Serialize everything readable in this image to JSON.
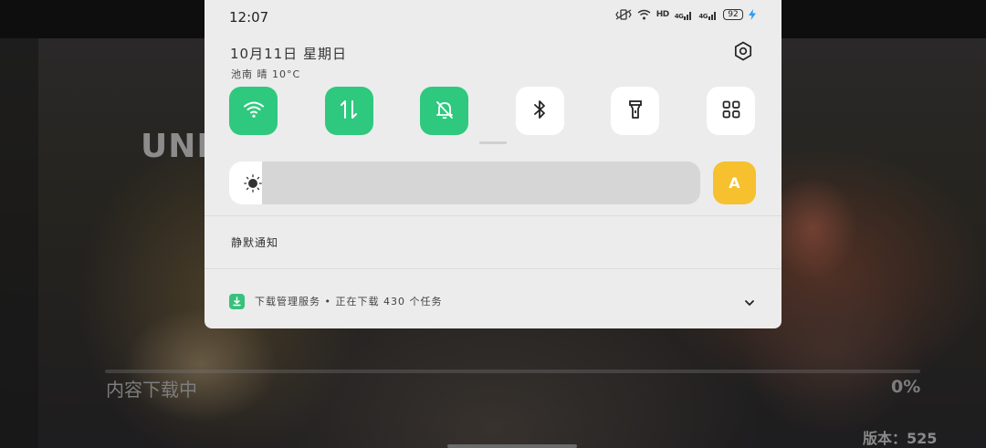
{
  "status_bar": {
    "time": "12:07",
    "hd_label": "HD",
    "network_1": "4G",
    "network_2": "4G",
    "battery_level": "92",
    "charging_icon": "bolt-icon"
  },
  "header": {
    "date": "10月11日  星期日",
    "weather": "池南 晴 10°C",
    "settings_icon": "gear-icon"
  },
  "quick_tiles": [
    {
      "name": "wifi",
      "icon": "wifi-icon",
      "on": true
    },
    {
      "name": "mobile-data",
      "icon": "data-arrows-icon",
      "on": true
    },
    {
      "name": "silent",
      "icon": "bell-off-icon",
      "on": true
    },
    {
      "name": "bluetooth",
      "icon": "bluetooth-icon",
      "on": false
    },
    {
      "name": "flashlight",
      "icon": "flashlight-icon",
      "on": false
    },
    {
      "name": "more",
      "icon": "grid-icon",
      "on": false
    }
  ],
  "brightness": {
    "level": 0.07,
    "icon": "sun-icon",
    "auto_label": "A"
  },
  "notifications": {
    "section_label": "静默通知",
    "item": {
      "app_icon": "download-icon",
      "text": "下载管理服务 • 正在下载 430 个任务",
      "expand_icon": "chevron-down-icon"
    }
  },
  "game": {
    "logo_text": "UND",
    "loading_label": "内容下载中",
    "loading_percent": "0%",
    "progress": 0.0,
    "version_text": "版本：525"
  },
  "colors": {
    "tile_on": "#2ec97e",
    "tile_off": "#ffffff",
    "auto_brightness": "#f7c02e",
    "shade_bg": "#ececec"
  }
}
